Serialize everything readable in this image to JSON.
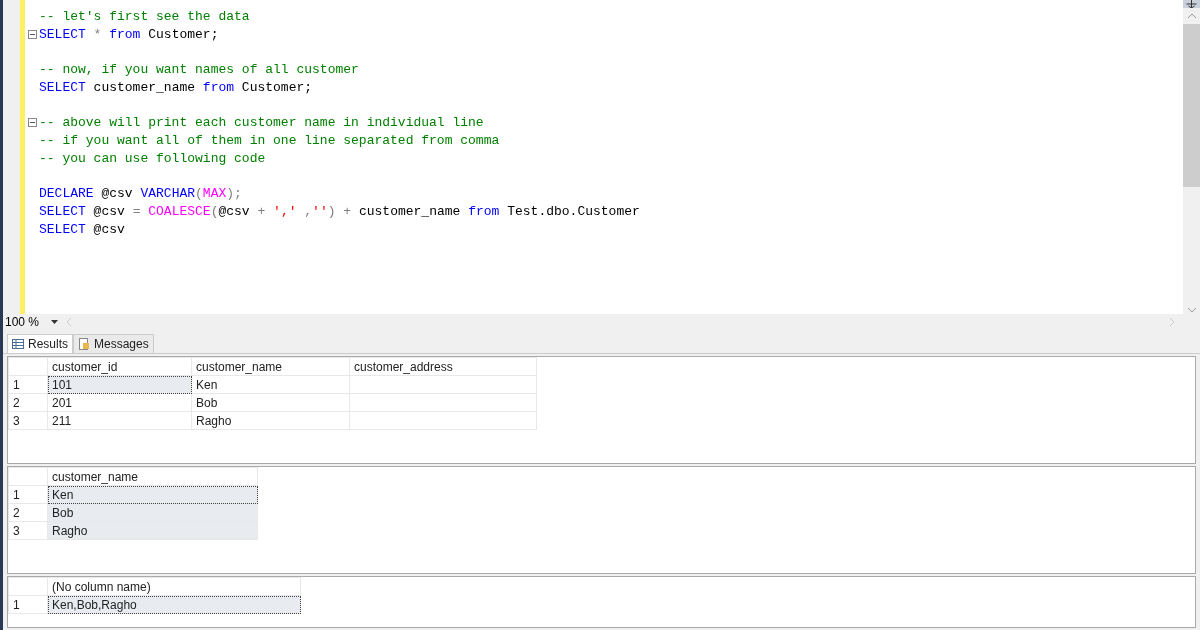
{
  "editor": {
    "lines": [
      {
        "fold": false,
        "tokens": [
          {
            "kind": "comment",
            "text": "-- let's first see the data"
          }
        ]
      },
      {
        "fold": true,
        "tokens": [
          {
            "kind": "keyword",
            "text": "SELECT"
          },
          {
            "kind": "operator",
            "text": " * "
          },
          {
            "kind": "keyword",
            "text": "from"
          },
          {
            "kind": "plain",
            "text": " Customer;"
          }
        ]
      },
      {
        "fold": false
      },
      {
        "fold": false,
        "tokens": [
          {
            "kind": "comment",
            "text": "-- now, if you want names of all customer"
          }
        ]
      },
      {
        "fold": false,
        "tokens": [
          {
            "kind": "keyword",
            "text": "SELECT"
          },
          {
            "kind": "plain",
            "text": " customer_name "
          },
          {
            "kind": "keyword",
            "text": "from"
          },
          {
            "kind": "plain",
            "text": " Customer;"
          }
        ]
      },
      {
        "fold": false
      },
      {
        "fold": true,
        "tokens": [
          {
            "kind": "comment",
            "text": "-- above will print each customer name in individual line"
          }
        ]
      },
      {
        "fold": false,
        "tokens": [
          {
            "kind": "comment",
            "text": "-- if you want all of them in one line separated from comma"
          }
        ]
      },
      {
        "fold": false,
        "tokens": [
          {
            "kind": "comment",
            "text": "-- you can use following code"
          }
        ]
      },
      {
        "fold": false
      },
      {
        "fold": false,
        "tokens": [
          {
            "kind": "keyword",
            "text": "DECLARE"
          },
          {
            "kind": "plain",
            "text": " @csv "
          },
          {
            "kind": "keyword",
            "text": "VARCHAR"
          },
          {
            "kind": "operator",
            "text": "("
          },
          {
            "kind": "function",
            "text": "MAX"
          },
          {
            "kind": "operator",
            "text": ");"
          }
        ]
      },
      {
        "fold": false,
        "tokens": [
          {
            "kind": "keyword",
            "text": "SELECT"
          },
          {
            "kind": "plain",
            "text": " @csv "
          },
          {
            "kind": "operator",
            "text": "= "
          },
          {
            "kind": "function",
            "text": "COALESCE"
          },
          {
            "kind": "operator",
            "text": "("
          },
          {
            "kind": "plain",
            "text": "@csv "
          },
          {
            "kind": "operator",
            "text": "+ "
          },
          {
            "kind": "string",
            "text": "','"
          },
          {
            "kind": "operator",
            "text": " ,"
          },
          {
            "kind": "string",
            "text": "''"
          },
          {
            "kind": "operator",
            "text": ") + "
          },
          {
            "kind": "plain",
            "text": "customer_name "
          },
          {
            "kind": "keyword",
            "text": "from"
          },
          {
            "kind": "plain",
            "text": " Test.dbo.Customer"
          }
        ]
      },
      {
        "fold": false,
        "tokens": [
          {
            "kind": "keyword",
            "text": "SELECT"
          },
          {
            "kind": "plain",
            "text": " @csv"
          }
        ]
      }
    ]
  },
  "zoom": "100 %",
  "tabs": [
    {
      "label": "Results",
      "selected": true
    },
    {
      "label": "Messages",
      "selected": false
    }
  ],
  "grids": [
    {
      "columns": [
        "customer_id",
        "customer_name",
        "customer_address"
      ],
      "rows": [
        {
          "num": "1",
          "cells": [
            {
              "text": "101",
              "selected": true
            },
            {
              "text": "Ken",
              "selected": false
            },
            {
              "text": "",
              "selected": false
            }
          ]
        },
        {
          "num": "2",
          "cells": [
            {
              "text": "201",
              "selected": false
            },
            {
              "text": "Bob",
              "selected": false
            },
            {
              "text": "",
              "selected": false
            }
          ]
        },
        {
          "num": "3",
          "cells": [
            {
              "text": "211",
              "selected": false
            },
            {
              "text": "Ragho",
              "selected": false
            },
            {
              "text": "",
              "selected": false
            }
          ]
        }
      ]
    },
    {
      "columns": [
        "customer_name"
      ],
      "rows": [
        {
          "num": "1",
          "cells": [
            {
              "text": "Ken",
              "selected": true
            }
          ]
        },
        {
          "num": "2",
          "cells": [
            {
              "text": "Bob",
              "selected": true
            }
          ]
        },
        {
          "num": "3",
          "cells": [
            {
              "text": "Ragho",
              "selected": true
            }
          ]
        }
      ]
    },
    {
      "columns": [
        "(No column name)"
      ],
      "rows": [
        {
          "num": "1",
          "cells": [
            {
              "text": "Ken,Bob,Ragho",
              "selected": true
            }
          ]
        }
      ]
    }
  ]
}
